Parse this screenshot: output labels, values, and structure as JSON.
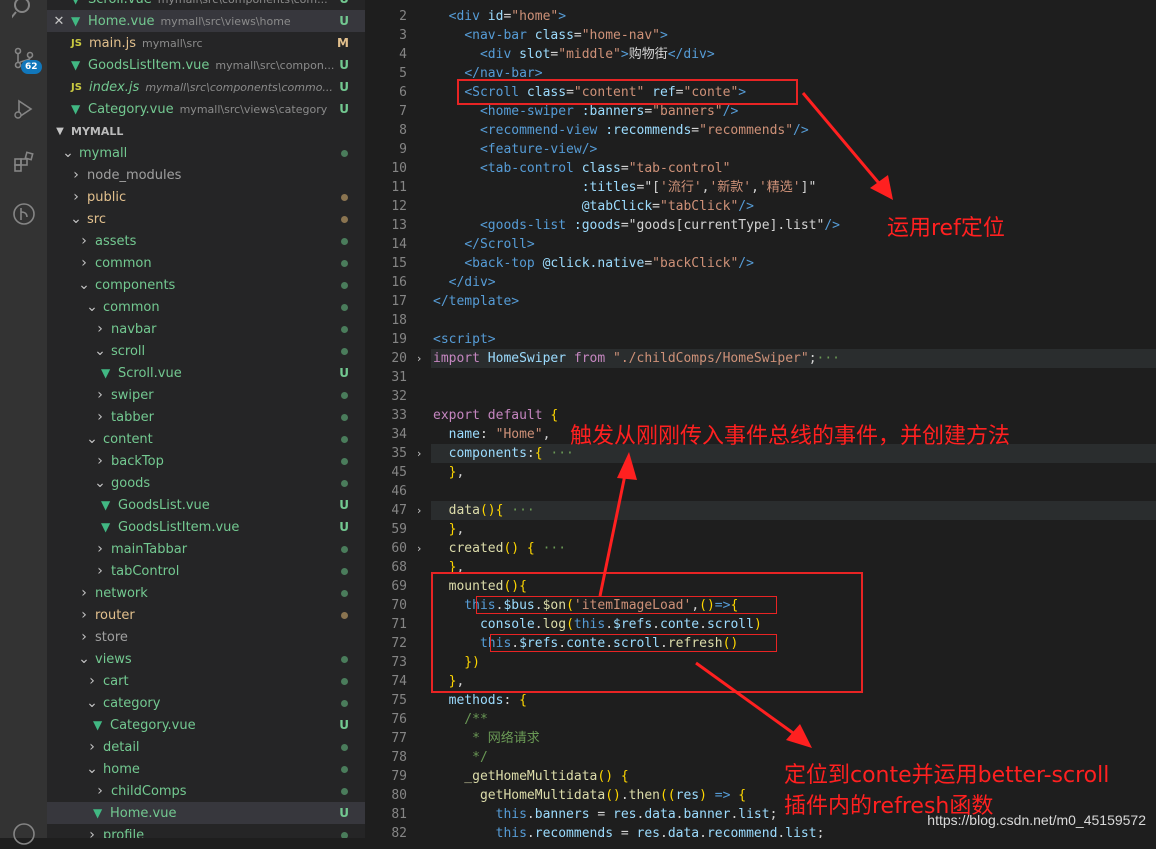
{
  "activity": {
    "badge": "62"
  },
  "sidebar": {
    "open_editors": [
      {
        "name": "Scroll.vue",
        "path": "mymall\\src\\components\\com...",
        "status": "U",
        "type": "vue"
      },
      {
        "name": "Home.vue",
        "path": "mymall\\src\\views\\home",
        "status": "U",
        "type": "vue",
        "selected": true
      },
      {
        "name": "main.js",
        "path": "mymall\\src",
        "status": "M",
        "type": "js"
      },
      {
        "name": "GoodsListItem.vue",
        "path": "mymall\\src\\compon...",
        "status": "U",
        "type": "vue"
      },
      {
        "name": "index.js",
        "path": "mymall\\src\\components\\commo...",
        "status": "U",
        "type": "js"
      },
      {
        "name": "Category.vue",
        "path": "mymall\\src\\views\\category",
        "status": "U",
        "type": "vue"
      }
    ],
    "section_title": "MYMALL",
    "tree": [
      {
        "label": "mymall",
        "depth": 0,
        "icon": "open",
        "mark": "g"
      },
      {
        "label": "node_modules",
        "depth": 1,
        "icon": "closed",
        "mark": ""
      },
      {
        "label": "public",
        "depth": 1,
        "icon": "closed",
        "mark": "y"
      },
      {
        "label": "src",
        "depth": 1,
        "icon": "open",
        "mark": "y"
      },
      {
        "label": "assets",
        "depth": 2,
        "icon": "closed",
        "mark": "g"
      },
      {
        "label": "common",
        "depth": 2,
        "icon": "closed",
        "mark": "g"
      },
      {
        "label": "components",
        "depth": 2,
        "icon": "open",
        "mark": "g"
      },
      {
        "label": "common",
        "depth": 3,
        "icon": "open",
        "mark": "g"
      },
      {
        "label": "navbar",
        "depth": 4,
        "icon": "closed",
        "mark": "g"
      },
      {
        "label": "scroll",
        "depth": 4,
        "icon": "open",
        "mark": "g"
      },
      {
        "label": "Scroll.vue",
        "depth": 5,
        "icon": "vue",
        "mark": "U"
      },
      {
        "label": "swiper",
        "depth": 4,
        "icon": "closed",
        "mark": "g"
      },
      {
        "label": "tabber",
        "depth": 4,
        "icon": "closed",
        "mark": "g"
      },
      {
        "label": "content",
        "depth": 3,
        "icon": "open",
        "mark": "g"
      },
      {
        "label": "backTop",
        "depth": 4,
        "icon": "closed",
        "mark": "g"
      },
      {
        "label": "goods",
        "depth": 4,
        "icon": "open",
        "mark": "g"
      },
      {
        "label": "GoodsList.vue",
        "depth": 5,
        "icon": "vue",
        "mark": "U"
      },
      {
        "label": "GoodsListItem.vue",
        "depth": 5,
        "icon": "vue",
        "mark": "U"
      },
      {
        "label": "mainTabbar",
        "depth": 4,
        "icon": "closed",
        "mark": "g"
      },
      {
        "label": "tabControl",
        "depth": 4,
        "icon": "closed",
        "mark": "g"
      },
      {
        "label": "network",
        "depth": 2,
        "icon": "closed",
        "mark": "g"
      },
      {
        "label": "router",
        "depth": 2,
        "icon": "closed",
        "mark": "y"
      },
      {
        "label": "store",
        "depth": 2,
        "icon": "closed",
        "mark": ""
      },
      {
        "label": "views",
        "depth": 2,
        "icon": "open",
        "mark": "g"
      },
      {
        "label": "cart",
        "depth": 3,
        "icon": "closed",
        "mark": "g"
      },
      {
        "label": "category",
        "depth": 3,
        "icon": "open",
        "mark": "g"
      },
      {
        "label": "Category.vue",
        "depth": 4,
        "icon": "vue",
        "mark": "U"
      },
      {
        "label": "detail",
        "depth": 3,
        "icon": "closed",
        "mark": "g"
      },
      {
        "label": "home",
        "depth": 3,
        "icon": "open",
        "mark": "g"
      },
      {
        "label": "childComps",
        "depth": 4,
        "icon": "closed",
        "mark": "g"
      },
      {
        "label": "Home.vue",
        "depth": 4,
        "icon": "vue",
        "mark": "U",
        "selected": true
      },
      {
        "label": "profile",
        "depth": 3,
        "icon": "closed",
        "mark": "g"
      }
    ]
  },
  "editor": {
    "lines": [
      {
        "n": "2",
        "segs": [
          [
            "p",
            "  "
          ],
          [
            "t",
            "<div"
          ],
          [
            "a",
            " id"
          ],
          [
            "p",
            "="
          ],
          [
            "s",
            "\"home\""
          ],
          [
            "t",
            ">"
          ]
        ]
      },
      {
        "n": "3",
        "segs": [
          [
            "p",
            "    "
          ],
          [
            "t",
            "<nav-bar"
          ],
          [
            "a",
            " class"
          ],
          [
            "p",
            "="
          ],
          [
            "s",
            "\"home-nav\""
          ],
          [
            "t",
            ">"
          ]
        ]
      },
      {
        "n": "4",
        "segs": [
          [
            "p",
            "      "
          ],
          [
            "t",
            "<div"
          ],
          [
            "a",
            " slot"
          ],
          [
            "p",
            "="
          ],
          [
            "s",
            "\"middle\""
          ],
          [
            "t",
            ">"
          ],
          [
            "p",
            "购物街"
          ],
          [
            "t",
            "</div>"
          ]
        ]
      },
      {
        "n": "5",
        "segs": [
          [
            "p",
            "    "
          ],
          [
            "t",
            "</nav-bar>"
          ]
        ]
      },
      {
        "n": "6",
        "segs": [
          [
            "p",
            "    "
          ],
          [
            "t",
            "<Scroll"
          ],
          [
            "a",
            " class"
          ],
          [
            "p",
            "="
          ],
          [
            "s",
            "\"content\""
          ],
          [
            "a",
            " ref"
          ],
          [
            "p",
            "="
          ],
          [
            "s",
            "\"conte\""
          ],
          [
            "t",
            ">"
          ]
        ]
      },
      {
        "n": "7",
        "segs": [
          [
            "p",
            "      "
          ],
          [
            "t",
            "<home-swiper"
          ],
          [
            "a",
            " :banners"
          ],
          [
            "p",
            "="
          ],
          [
            "s",
            "\"banners\""
          ],
          [
            "t",
            "/>"
          ]
        ]
      },
      {
        "n": "8",
        "segs": [
          [
            "p",
            "      "
          ],
          [
            "t",
            "<recommend-view"
          ],
          [
            "a",
            " :recommends"
          ],
          [
            "p",
            "="
          ],
          [
            "s",
            "\"recommends\""
          ],
          [
            "t",
            "/>"
          ]
        ]
      },
      {
        "n": "9",
        "segs": [
          [
            "p",
            "      "
          ],
          [
            "t",
            "<feature-view/>"
          ]
        ]
      },
      {
        "n": "10",
        "segs": [
          [
            "p",
            "      "
          ],
          [
            "t",
            "<tab-control"
          ],
          [
            "a",
            " class"
          ],
          [
            "p",
            "="
          ],
          [
            "s",
            "\"tab-control\""
          ]
        ]
      },
      {
        "n": "11",
        "segs": [
          [
            "p",
            "                   "
          ],
          [
            "a",
            ":titles"
          ],
          [
            "p",
            "=\"["
          ],
          [
            "s",
            "'流行'"
          ],
          [
            "p",
            ","
          ],
          [
            "s",
            "'新款'"
          ],
          [
            "p",
            ","
          ],
          [
            "s",
            "'精选'"
          ],
          [
            "p",
            "]\""
          ]
        ]
      },
      {
        "n": "12",
        "segs": [
          [
            "p",
            "                   "
          ],
          [
            "a",
            "@tabClick"
          ],
          [
            "p",
            "="
          ],
          [
            "s",
            "\"tabClick\""
          ],
          [
            "t",
            "/>"
          ]
        ]
      },
      {
        "n": "13",
        "segs": [
          [
            "p",
            "      "
          ],
          [
            "t",
            "<goods-list"
          ],
          [
            "a",
            " :goods"
          ],
          [
            "p",
            "=\"goods[currentType].list\""
          ],
          [
            "t",
            "/>"
          ]
        ]
      },
      {
        "n": "14",
        "segs": [
          [
            "p",
            "    "
          ],
          [
            "t",
            "</Scroll>"
          ]
        ]
      },
      {
        "n": "15",
        "segs": [
          [
            "p",
            "    "
          ],
          [
            "t",
            "<back-top"
          ],
          [
            "a",
            " @click.native"
          ],
          [
            "p",
            "="
          ],
          [
            "s",
            "\"backClick\""
          ],
          [
            "t",
            "/>"
          ]
        ]
      },
      {
        "n": "16",
        "segs": [
          [
            "p",
            "  "
          ],
          [
            "t",
            "</div>"
          ]
        ]
      },
      {
        "n": "17",
        "segs": [
          [
            "t",
            "</template>"
          ]
        ]
      },
      {
        "n": "18",
        "segs": []
      },
      {
        "n": "19",
        "segs": [
          [
            "t",
            "<script>"
          ]
        ]
      },
      {
        "n": "20",
        "fold": true,
        "hl": true,
        "segs": [
          [
            "k",
            "import"
          ],
          [
            "a",
            " HomeSwiper"
          ],
          [
            "k",
            " from"
          ],
          [
            "s",
            " \"./childComps/HomeSwiper\""
          ],
          [
            "p",
            ";"
          ],
          [
            "c",
            "···"
          ]
        ]
      },
      {
        "n": "31",
        "segs": []
      },
      {
        "n": "32",
        "segs": []
      },
      {
        "n": "33",
        "segs": [
          [
            "k",
            "export"
          ],
          [
            "k",
            " default"
          ],
          [
            "b",
            " {"
          ]
        ]
      },
      {
        "n": "34",
        "segs": [
          [
            "a",
            "  name"
          ],
          [
            "p",
            ": "
          ],
          [
            "s",
            "\"Home\""
          ],
          [
            "p",
            ","
          ]
        ]
      },
      {
        "n": "35",
        "fold": true,
        "hl": true,
        "segs": [
          [
            "a",
            "  components"
          ],
          [
            "p",
            ":"
          ],
          [
            "b",
            "{"
          ],
          [
            "c",
            " ···"
          ]
        ]
      },
      {
        "n": "45",
        "segs": [
          [
            "b",
            "  }"
          ],
          [
            "p",
            ","
          ]
        ]
      },
      {
        "n": "46",
        "segs": []
      },
      {
        "n": "47",
        "fold": true,
        "hl": true,
        "segs": [
          [
            "f",
            "  data"
          ],
          [
            "b",
            "()"
          ],
          [
            "b",
            "{"
          ],
          [
            "c",
            " ···"
          ]
        ]
      },
      {
        "n": "59",
        "segs": [
          [
            "b",
            "  }"
          ],
          [
            "p",
            ","
          ]
        ]
      },
      {
        "n": "60",
        "fold": true,
        "segs": [
          [
            "f",
            "  created"
          ],
          [
            "b",
            "()"
          ],
          [
            "b",
            " {"
          ],
          [
            "c",
            " ···"
          ]
        ]
      },
      {
        "n": "68",
        "segs": [
          [
            "b",
            "  }"
          ],
          [
            "p",
            ","
          ]
        ]
      },
      {
        "n": "69",
        "segs": [
          [
            "f",
            "  mounted"
          ],
          [
            "b",
            "()"
          ],
          [
            "b",
            "{"
          ]
        ]
      },
      {
        "n": "70",
        "segs": [
          [
            "th",
            "    this"
          ],
          [
            "p",
            "."
          ],
          [
            "a",
            "$bus"
          ],
          [
            "p",
            "."
          ],
          [
            "f",
            "$on"
          ],
          [
            "b",
            "("
          ],
          [
            "s",
            "'itemImageLoad'"
          ],
          [
            "p",
            ","
          ],
          [
            "b",
            "()"
          ],
          [
            "t",
            "=>"
          ],
          [
            "b",
            "{"
          ]
        ]
      },
      {
        "n": "71",
        "segs": [
          [
            "a",
            "      console"
          ],
          [
            "p",
            "."
          ],
          [
            "f",
            "log"
          ],
          [
            "b",
            "("
          ],
          [
            "th",
            "this"
          ],
          [
            "p",
            "."
          ],
          [
            "a",
            "$refs"
          ],
          [
            "p",
            "."
          ],
          [
            "a",
            "conte"
          ],
          [
            "p",
            "."
          ],
          [
            "a",
            "scroll"
          ],
          [
            "b",
            ")"
          ]
        ]
      },
      {
        "n": "72",
        "segs": [
          [
            "th",
            "      this"
          ],
          [
            "p",
            "."
          ],
          [
            "a",
            "$refs"
          ],
          [
            "p",
            "."
          ],
          [
            "a",
            "conte"
          ],
          [
            "p",
            "."
          ],
          [
            "a",
            "scroll"
          ],
          [
            "p",
            "."
          ],
          [
            "f",
            "refresh"
          ],
          [
            "b",
            "()"
          ]
        ]
      },
      {
        "n": "73",
        "segs": [
          [
            "b",
            "    })"
          ]
        ]
      },
      {
        "n": "74",
        "segs": [
          [
            "b",
            "  }"
          ],
          [
            "p",
            ","
          ]
        ]
      },
      {
        "n": "75",
        "segs": [
          [
            "a",
            "  methods"
          ],
          [
            "p",
            ": "
          ],
          [
            "b",
            "{"
          ]
        ]
      },
      {
        "n": "76",
        "segs": [
          [
            "c",
            "    /**"
          ]
        ]
      },
      {
        "n": "77",
        "segs": [
          [
            "c",
            "     * 网络请求"
          ]
        ]
      },
      {
        "n": "78",
        "segs": [
          [
            "c",
            "     */"
          ]
        ]
      },
      {
        "n": "79",
        "segs": [
          [
            "f",
            "    _getHomeMultidata"
          ],
          [
            "b",
            "()"
          ],
          [
            "b",
            " {"
          ]
        ]
      },
      {
        "n": "80",
        "segs": [
          [
            "f",
            "      getHomeMultidata"
          ],
          [
            "b",
            "()"
          ],
          [
            "p",
            "."
          ],
          [
            "f",
            "then"
          ],
          [
            "b",
            "(("
          ],
          [
            "a",
            "res"
          ],
          [
            "b",
            ")"
          ],
          [
            "t",
            " =>"
          ],
          [
            "b",
            " {"
          ]
        ]
      },
      {
        "n": "81",
        "segs": [
          [
            "th",
            "        this"
          ],
          [
            "p",
            "."
          ],
          [
            "a",
            "banners"
          ],
          [
            "p",
            " = "
          ],
          [
            "a",
            "res"
          ],
          [
            "p",
            "."
          ],
          [
            "a",
            "data"
          ],
          [
            "p",
            "."
          ],
          [
            "a",
            "banner"
          ],
          [
            "p",
            "."
          ],
          [
            "a",
            "list"
          ],
          [
            "p",
            ";"
          ]
        ]
      },
      {
        "n": "82",
        "segs": [
          [
            "th",
            "        this"
          ],
          [
            "p",
            "."
          ],
          [
            "a",
            "recommends"
          ],
          [
            "p",
            " = "
          ],
          [
            "a",
            "res"
          ],
          [
            "p",
            "."
          ],
          [
            "a",
            "data"
          ],
          [
            "p",
            "."
          ],
          [
            "a",
            "recommend"
          ],
          [
            "p",
            "."
          ],
          [
            "a",
            "list"
          ],
          [
            "p",
            ";"
          ]
        ]
      }
    ]
  },
  "annotations": {
    "ref": "运用ref定位",
    "bus": "触发从刚刚传入事件总线的事件，并创建方法",
    "refresh_line1": "定位到conte并运用better-scroll",
    "refresh_line2": "插件内的refresh函数"
  },
  "watermark": "https://blog.csdn.net/m0_45159572"
}
